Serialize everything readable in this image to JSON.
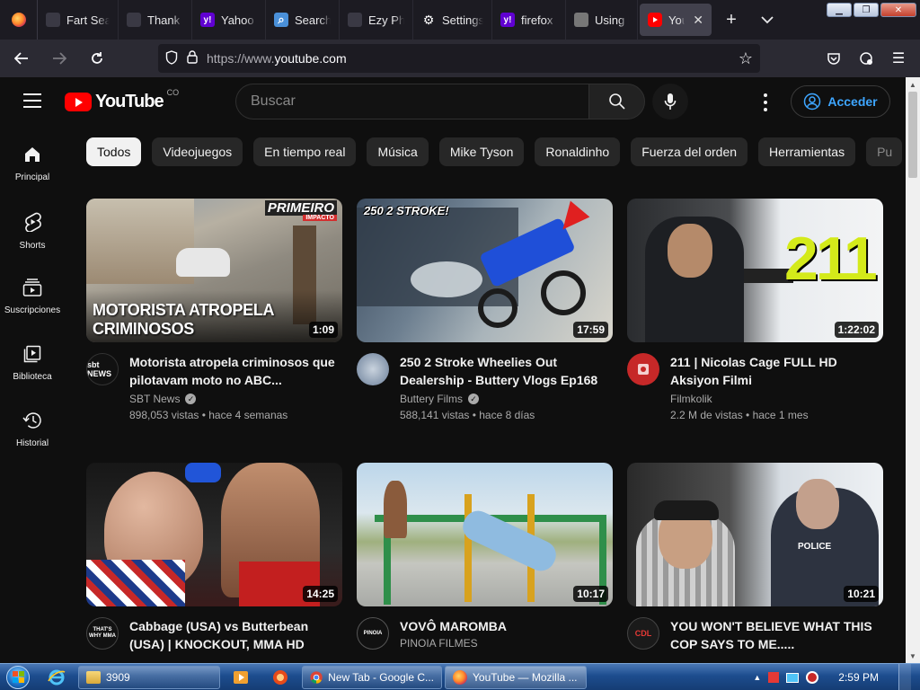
{
  "browser": {
    "tabs": [
      {
        "title": "Fart Search",
        "favicon": "moon-icon",
        "color": "#3a3944"
      },
      {
        "title": "Thank Y",
        "favicon": "shield-icon",
        "color": "#3a3944"
      },
      {
        "title": "Yahoo |",
        "favicon": "yahoo-icon",
        "color": "#6001d2"
      },
      {
        "title": "Search |",
        "favicon": "search-icon",
        "color": "#4a90d9"
      },
      {
        "title": "Ezy Pho",
        "favicon": "photo-icon",
        "color": "#3a3944"
      },
      {
        "title": "Settings",
        "favicon": "gear-icon",
        "color": "#3a3944"
      },
      {
        "title": "firefox a",
        "favicon": "yahoo-icon",
        "color": "#6001d2"
      },
      {
        "title": "Using k",
        "favicon": "document-icon",
        "color": "#777777"
      },
      {
        "title": "YouT",
        "favicon": "youtube-icon",
        "color": "#ff0000",
        "active": true
      }
    ],
    "url_prefix": "https://www.",
    "url_domain": "youtube.com"
  },
  "youtube": {
    "country_code": "CO",
    "search_placeholder": "Buscar",
    "signin_label": "Acceder",
    "sidebar": [
      {
        "label": "Principal",
        "icon": "home-icon"
      },
      {
        "label": "Shorts",
        "icon": "shorts-icon"
      },
      {
        "label": "Suscripciones",
        "icon": "subscriptions-icon"
      },
      {
        "label": "Biblioteca",
        "icon": "library-icon"
      },
      {
        "label": "Historial",
        "icon": "history-icon"
      }
    ],
    "chips": [
      "Todos",
      "Videojuegos",
      "En tiempo real",
      "Música",
      "Mike Tyson",
      "Ronaldinho",
      "Fuerza del orden",
      "Herramientas",
      "Pu"
    ],
    "videos": [
      {
        "title": "Motorista atropela criminosos que pilotavam moto no ABC...",
        "channel": "SBT News",
        "verified": true,
        "stats": "898,053 vistas • hace 4 semanas",
        "duration": "1:09",
        "overlay": "MOTORISTA ATROPELA\nCRIMINOSOS",
        "corner": "PRIMEIRO",
        "corner_sub": "IMPACTO",
        "avatar_text": "sbt NEWS",
        "avatar_color": "#111111"
      },
      {
        "title": "250 2 Stroke Wheelies Out Dealership - Buttery Vlogs Ep168",
        "channel": "Buttery Films",
        "verified": true,
        "stats": "588,141 vistas • hace 8 días",
        "duration": "17:59",
        "corner": "250 2 STROKE!",
        "avatar_color": "#6b7f99"
      },
      {
        "title": "211 | Nicolas Cage FULL HD Aksiyon Filmi",
        "channel": "Filmkolik",
        "verified": false,
        "stats": "2.2 M de vistas • hace 1 mes",
        "duration": "1:22:02",
        "corner": "211",
        "avatar_color": "#c62828"
      },
      {
        "title": "Cabbage (USA) vs Butterbean (USA) | KNOCKOUT, MMA HD",
        "channel": "",
        "verified": false,
        "stats": "",
        "duration": "14:25",
        "avatar_text": "THAT'S WHY MMA",
        "avatar_color": "#111111"
      },
      {
        "title": "VOVÔ MAROMBA",
        "channel": "PINOIA FILMES",
        "verified": false,
        "stats": "",
        "duration": "10:17",
        "avatar_text": "PINOIA",
        "avatar_color": "#111111"
      },
      {
        "title": "YOU WON'T BELIEVE WHAT THIS COP SAYS TO ME.....",
        "channel": "",
        "verified": false,
        "stats": "",
        "duration": "10:21",
        "corner": "POLICE",
        "avatar_text": "CDL",
        "avatar_color": "#1a1a1a"
      }
    ]
  },
  "taskbar": {
    "tasks": [
      {
        "label": "3909",
        "icon": "folder-icon"
      },
      {
        "label": "New Tab - Google C...",
        "icon": "chrome-icon"
      },
      {
        "label": "YouTube — Mozilla ...",
        "icon": "firefox-icon"
      }
    ],
    "clock": "2:59 PM"
  }
}
